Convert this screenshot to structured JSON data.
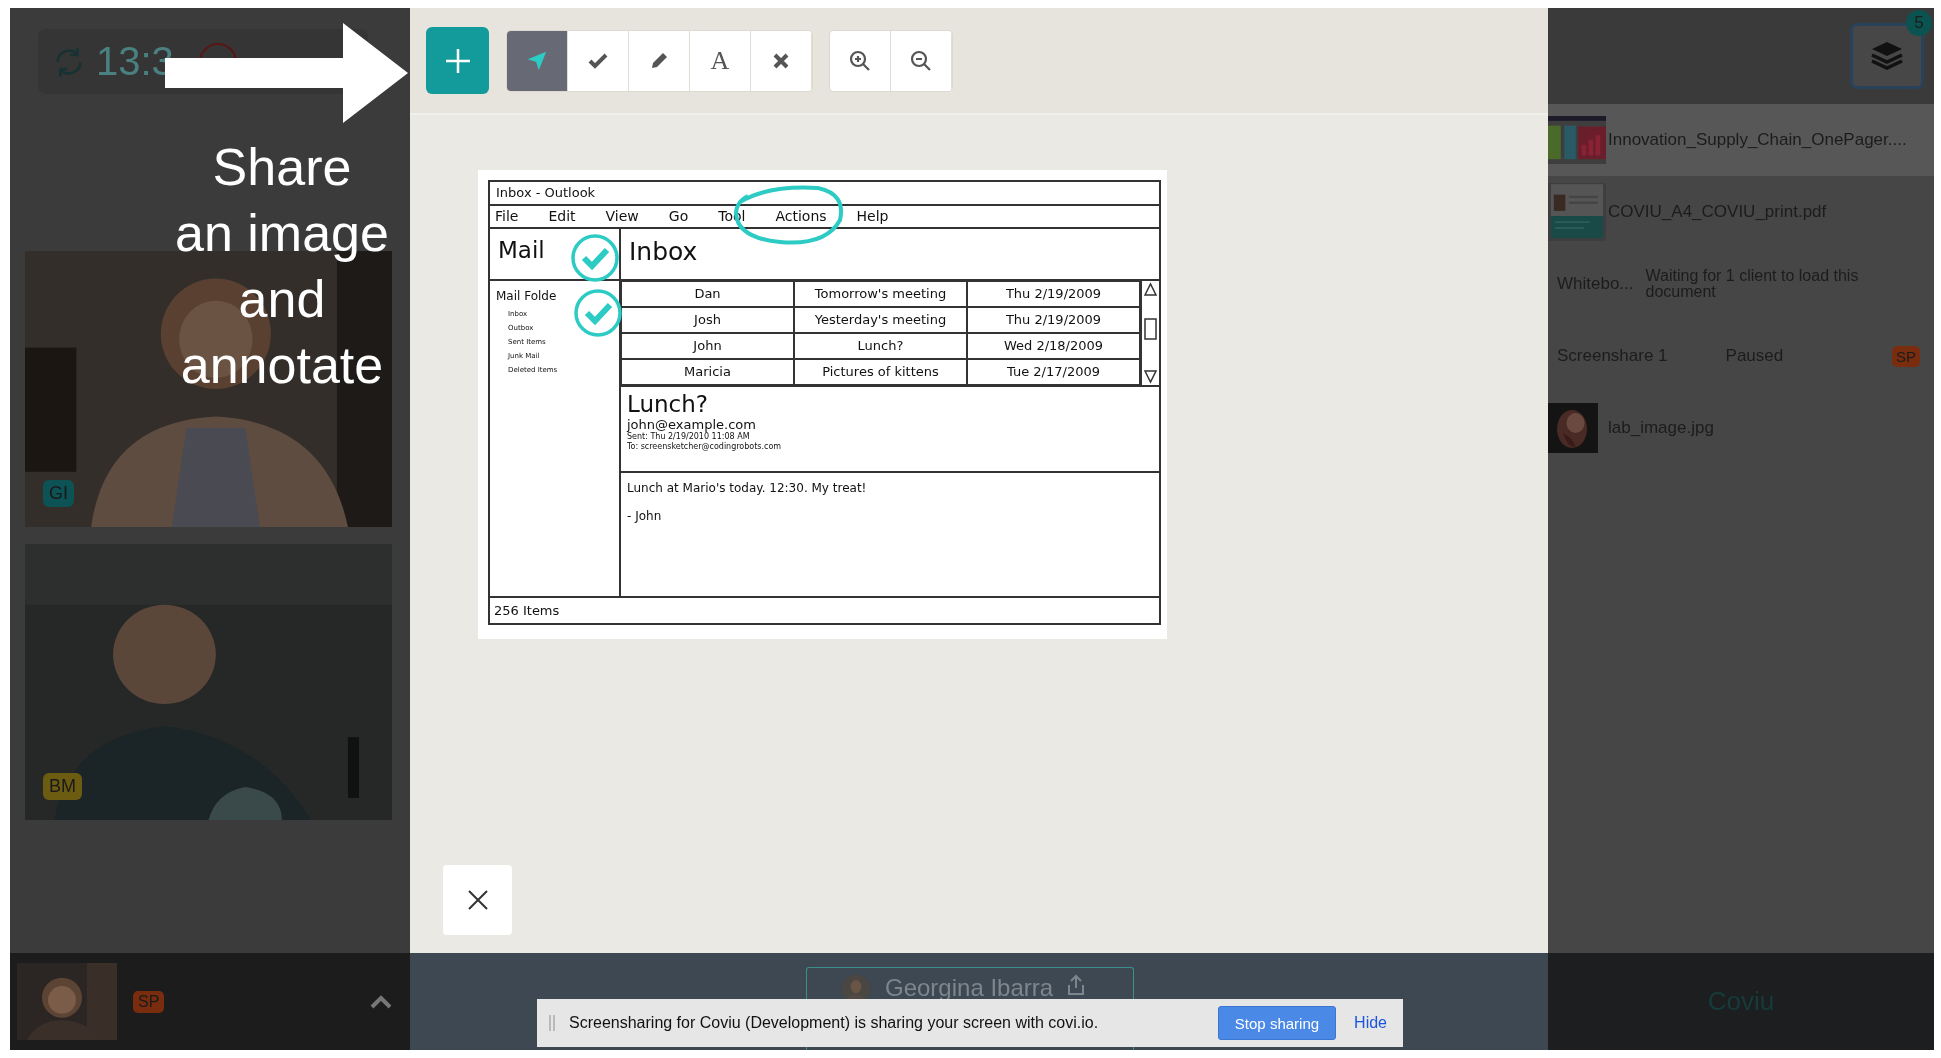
{
  "call_panel": {
    "clock": "13:3",
    "caption_lines": [
      "Share",
      "an image",
      "and",
      "annotate"
    ],
    "videos": [
      {
        "initials": "GI",
        "color": "#0d5254"
      },
      {
        "initials": "BM",
        "color": "#6b5c12"
      }
    ],
    "self_view": {
      "initials": "SP",
      "color": "#7a2d0e"
    }
  },
  "toolbar": {
    "tools": [
      {
        "kind": "pointer",
        "selected": true
      },
      {
        "kind": "tick",
        "selected": false
      },
      {
        "kind": "pencil",
        "selected": false
      },
      {
        "kind": "text",
        "label": "A",
        "selected": false
      },
      {
        "kind": "delete",
        "selected": false
      }
    ],
    "zoom": [
      {
        "kind": "zoom-in"
      },
      {
        "kind": "zoom-out"
      }
    ]
  },
  "document": {
    "title": "Inbox - Outlook",
    "menu": [
      "File",
      "Edit",
      "View",
      "Go",
      "Tool",
      "Actions",
      "Help"
    ],
    "pane_title": "Mail",
    "folders_heading": "Mail Folde",
    "folders": [
      "Inbox",
      "Outbox",
      "Sent Items",
      "Junk Mail",
      "Deleted Items"
    ],
    "list_title": "Inbox",
    "messages": [
      {
        "from": "Dan",
        "subject": "Tomorrow's meeting",
        "date": "Thu 2/19/2009"
      },
      {
        "from": "Josh",
        "subject": "Yesterday's meeting",
        "date": "Thu 2/19/2009"
      },
      {
        "from": "John",
        "subject": "Lunch?",
        "date": "Wed 2/18/2009"
      },
      {
        "from": "Maricia",
        "subject": "Pictures of kittens",
        "date": "Tue 2/17/2009"
      }
    ],
    "preview": {
      "subject": "Lunch?",
      "sender": "john@example.com",
      "sent": "Sent: Thu 2/19/2010 11:08 AM",
      "to": "To: screensketcher@codingrobots.com",
      "body": [
        "Lunch at Mario's today. 12:30. My treat!",
        "- John"
      ]
    },
    "status": "256 Items",
    "annotations": [
      {
        "kind": "circle"
      },
      {
        "kind": "check"
      },
      {
        "kind": "check"
      }
    ]
  },
  "presenter": {
    "name": "Georgina Ibarra"
  },
  "share_bar": {
    "message": "Screensharing for Coviu (Development) is sharing your screen with covi.io.",
    "buttons": [
      {
        "label": "Stop sharing",
        "kind": "primary"
      },
      {
        "label": "Hide",
        "kind": "link"
      }
    ]
  },
  "files": {
    "badge": "5",
    "items": [
      {
        "kind": "document",
        "name": "Innovation_Supply_Chain_OnePager....",
        "selected": true
      },
      {
        "kind": "document",
        "name": "COVIU_A4_COVIU_print.pdf",
        "selected": false
      },
      {
        "kind": "whiteboard",
        "name": "Whitebo...",
        "status": "Waiting for 1 client to load this document",
        "selected": false
      },
      {
        "kind": "screenshare",
        "name": "Screenshare 1",
        "status": "Paused",
        "badge": {
          "text": "SP",
          "color": "#7a2d0e"
        },
        "selected": false
      },
      {
        "name": "lab_image.jpg",
        "selected": false
      }
    ]
  },
  "footer": {
    "brand": "Coviu"
  }
}
